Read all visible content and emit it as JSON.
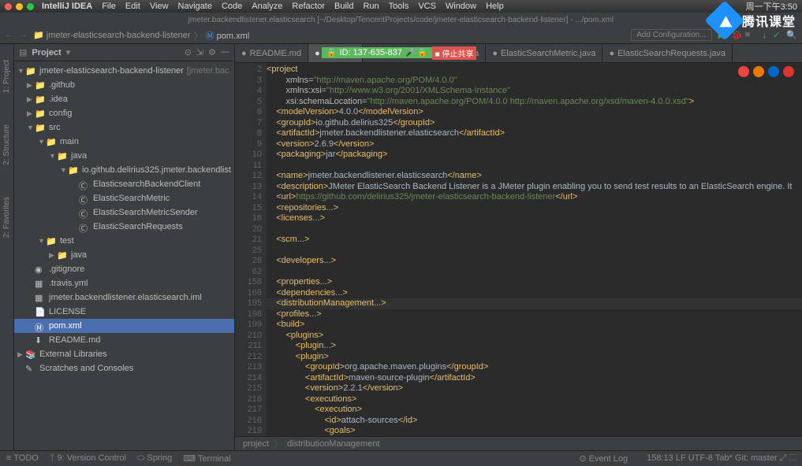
{
  "mac_menu": [
    "IntelliJ IDEA",
    "File",
    "Edit",
    "View",
    "Navigate",
    "Code",
    "Analyze",
    "Refactor",
    "Build",
    "Run",
    "Tools",
    "VCS",
    "Window",
    "Help"
  ],
  "mac_right": "周一下午3:50",
  "title": "jmeter.backendlistener.elasticsearch [~/Desktop/TencentProjects/code/jmeter-elasticsearch-backend-listener] - .../pom.xml",
  "nav": {
    "crumb1": "jmeter-elasticsearch-backend-listener",
    "crumb2": "pom.xml",
    "add": "Add Configuration..."
  },
  "project": {
    "title": "Project"
  },
  "tree": [
    {
      "d": 0,
      "a": "▼",
      "i": "📁",
      "t": "jmeter-elasticsearch-backend-listener",
      "e": "[jmeter.bac"
    },
    {
      "d": 1,
      "a": "▶",
      "i": "📁",
      "t": ".github"
    },
    {
      "d": 1,
      "a": "▶",
      "i": "📁",
      "t": ".idea"
    },
    {
      "d": 1,
      "a": "▶",
      "i": "📁",
      "t": "config"
    },
    {
      "d": 1,
      "a": "▼",
      "i": "📁",
      "t": "src"
    },
    {
      "d": 2,
      "a": "▼",
      "i": "📁",
      "t": "main"
    },
    {
      "d": 3,
      "a": "▼",
      "i": "📁",
      "t": "java"
    },
    {
      "d": 4,
      "a": "▼",
      "i": "📁",
      "t": "io.github.delirius325.jmeter.backendlist"
    },
    {
      "d": 5,
      "a": "",
      "i": "Ⓒ",
      "t": "ElasticsearchBackendClient"
    },
    {
      "d": 5,
      "a": "",
      "i": "Ⓒ",
      "t": "ElasticSearchMetric"
    },
    {
      "d": 5,
      "a": "",
      "i": "Ⓒ",
      "t": "ElasticSearchMetricSender"
    },
    {
      "d": 5,
      "a": "",
      "i": "Ⓒ",
      "t": "ElasticSearchRequests"
    },
    {
      "d": 2,
      "a": "▼",
      "i": "📁",
      "t": "test"
    },
    {
      "d": 3,
      "a": "▶",
      "i": "📁",
      "t": "java"
    },
    {
      "d": 1,
      "a": "",
      "i": "◉",
      "t": ".gitignore"
    },
    {
      "d": 1,
      "a": "",
      "i": "▦",
      "t": ".travis.yml"
    },
    {
      "d": 1,
      "a": "",
      "i": "▦",
      "t": "jmeter.backendlistener.elasticsearch.iml"
    },
    {
      "d": 1,
      "a": "",
      "i": "📄",
      "t": "LICENSE"
    },
    {
      "d": 1,
      "a": "",
      "i": "Ⓜ",
      "t": "pom.xml",
      "sel": true
    },
    {
      "d": 1,
      "a": "",
      "i": "⬇",
      "t": "README.md"
    },
    {
      "d": 0,
      "a": "▶",
      "i": "📚",
      "t": "External Libraries"
    },
    {
      "d": 0,
      "a": "",
      "i": "✎",
      "t": "Scratches and Consoles"
    }
  ],
  "tabs": [
    {
      "t": "README.md"
    },
    {
      "t": "pom.xml",
      "active": true
    },
    {
      "t": "cSearchMetricSender.java"
    },
    {
      "t": "ElasticSearchMetric.java"
    },
    {
      "t": "ElasticSearchRequests.java"
    }
  ],
  "share": {
    "id": "ID: 137-635-837",
    "stop": "■ 停止共享"
  },
  "gutter": [
    2,
    3,
    4,
    5,
    6,
    7,
    8,
    9,
    10,
    11,
    12,
    13,
    14,
    15,
    16,
    20,
    21,
    25,
    28,
    62,
    158,
    168,
    195,
    198,
    199,
    210,
    211,
    212,
    213,
    214,
    215,
    216,
    217,
    218,
    219
  ],
  "breadcrumb": [
    "project",
    "distributionManagement"
  ],
  "statusbar": {
    "left": [
      "≡ TODO",
      "ᛘ 9: Version Control",
      "⬭ Spring",
      "⌨ Terminal"
    ],
    "right": [
      "⊙ Event Log"
    ],
    "info": "158:13   LF   UTF-8   Tab*   Git: master   ⤢   ⬚"
  },
  "rails": [
    "1: Project",
    "2: Structure",
    "2: Favorites"
  ],
  "watermark": "腾讯课堂"
}
